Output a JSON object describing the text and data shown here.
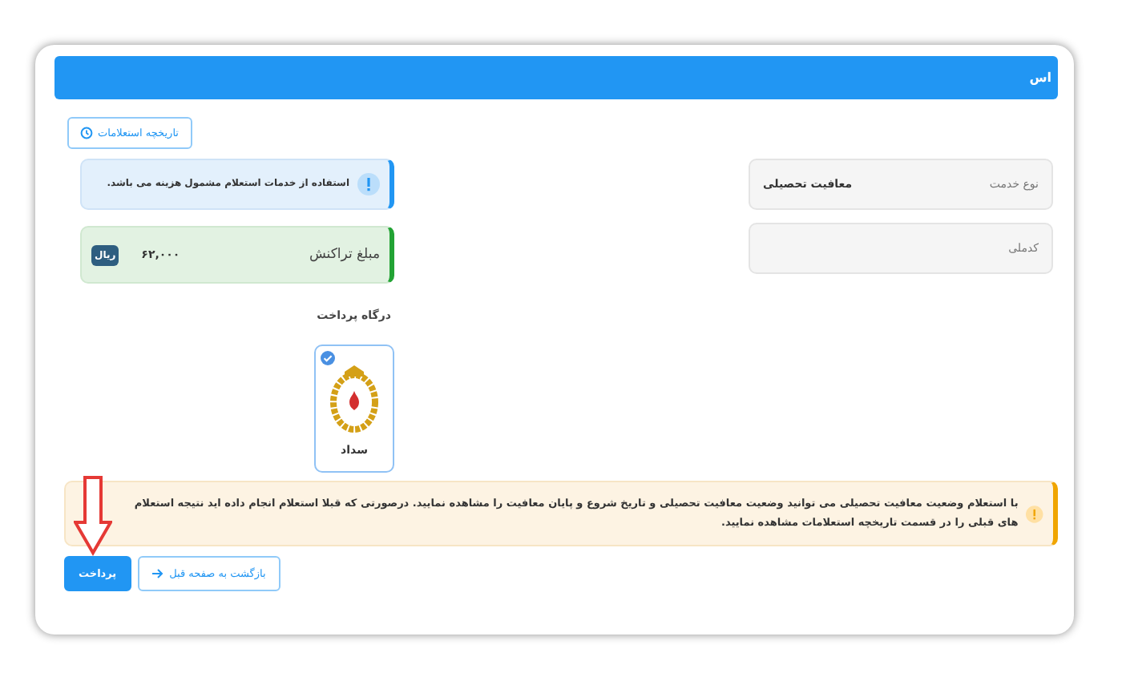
{
  "header": {
    "title": "اس"
  },
  "history_button": {
    "label": "تاریخچه استعلامات"
  },
  "fields": [
    {
      "label": "نوع خدمت",
      "value": "معافیت تحصیلی"
    },
    {
      "label": "کدملی"
    }
  ],
  "info_alert": {
    "text": "استفاده از خدمات استعلام مشمول هزینه می باشد."
  },
  "amount": {
    "label": "مبلغ تراکنش",
    "value": "۶۲,۰۰۰",
    "currency": "ریال"
  },
  "gateway": {
    "title": "درگاه پرداخت",
    "options": [
      {
        "name": "سداد",
        "selected": true
      }
    ]
  },
  "warning_alert": {
    "text": "با استعلام وضعیت معافیت تحصیلی می توانید وضعیت معافیت تحصیلی و تاریخ شروع و پایان معافیت را مشاهده نمایید. درصورتی که قبلا استعلام انجام داده اید نتیجه استعلام های قبلی را در قسمت تاریخچه استعلامات مشاهده نمایید."
  },
  "buttons": [
    {
      "label": "بازگشت به صفحه قبل",
      "kind": "outline"
    },
    {
      "label": "پرداخت",
      "kind": "primary"
    }
  ]
}
